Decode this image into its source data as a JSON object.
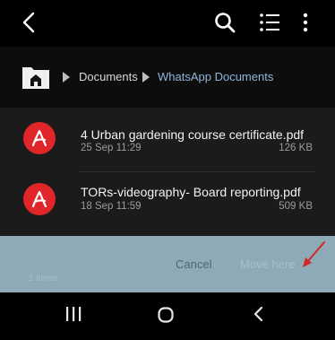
{
  "topbar": {
    "back_icon": "back-arrow-icon",
    "search_icon": "search-icon",
    "view_icon": "list-view-icon",
    "more_icon": "more-vertical-icon"
  },
  "breadcrumb": {
    "home_icon": "folder-home-icon",
    "items": [
      "Documents",
      "WhatsApp Documents"
    ],
    "active_color": "#8fb7dc"
  },
  "files": [
    {
      "name": "4 Urban gardening course certificate.pdf",
      "date": "25 Sep 11:29",
      "size": "126 KB",
      "icon": "pdf-icon"
    },
    {
      "name": "TORs-videography- Board reporting.pdf",
      "date": "18 Sep 11:59",
      "size": "509 KB",
      "icon": "pdf-icon"
    }
  ],
  "bottom_sheet": {
    "selected_caption": "1 items",
    "cancel_label": "Cancel",
    "move_label": "Move here",
    "background": "#8daab6"
  },
  "system_nav": {
    "recents_icon": "recents-icon",
    "home_icon": "home-circle-icon",
    "back_icon": "back-chevron-icon"
  },
  "colors": {
    "pdf_red": "#e0262b",
    "annotation_red": "#d3262b"
  }
}
